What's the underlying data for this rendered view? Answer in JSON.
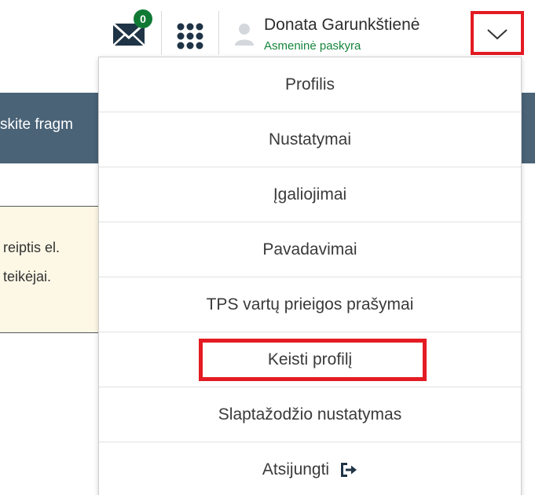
{
  "header": {
    "mail": {
      "icon": "envelope-icon",
      "unread_count": "0"
    },
    "apps_icon": "grid-dots-icon",
    "user": {
      "avatar_icon": "user-avatar-icon",
      "name": "Donata Garunkštienė",
      "account_type": "Asmeninė paskyra"
    },
    "dropdown_icon": "chevron-down-icon"
  },
  "background": {
    "banner_text": "skite fragm",
    "notice_lines": [
      "reiptis el.",
      "teikėjai."
    ]
  },
  "menu": {
    "items": [
      {
        "label": "Profilis"
      },
      {
        "label": "Nustatymai"
      },
      {
        "label": "Įgaliojimai"
      },
      {
        "label": "Pavadavimai"
      },
      {
        "label": "TPS vartų prieigos prašymai"
      },
      {
        "label": "Keisti profilį"
      },
      {
        "label": "Slaptažodžio nustatymas"
      },
      {
        "label": "Atsijungti",
        "icon": "logout-icon"
      }
    ]
  },
  "colors": {
    "highlight": "#e41b23",
    "badge": "#107a35",
    "account_type_text": "#15863d",
    "banner": "#4a6377",
    "notice_bg": "#fdf8e6"
  }
}
